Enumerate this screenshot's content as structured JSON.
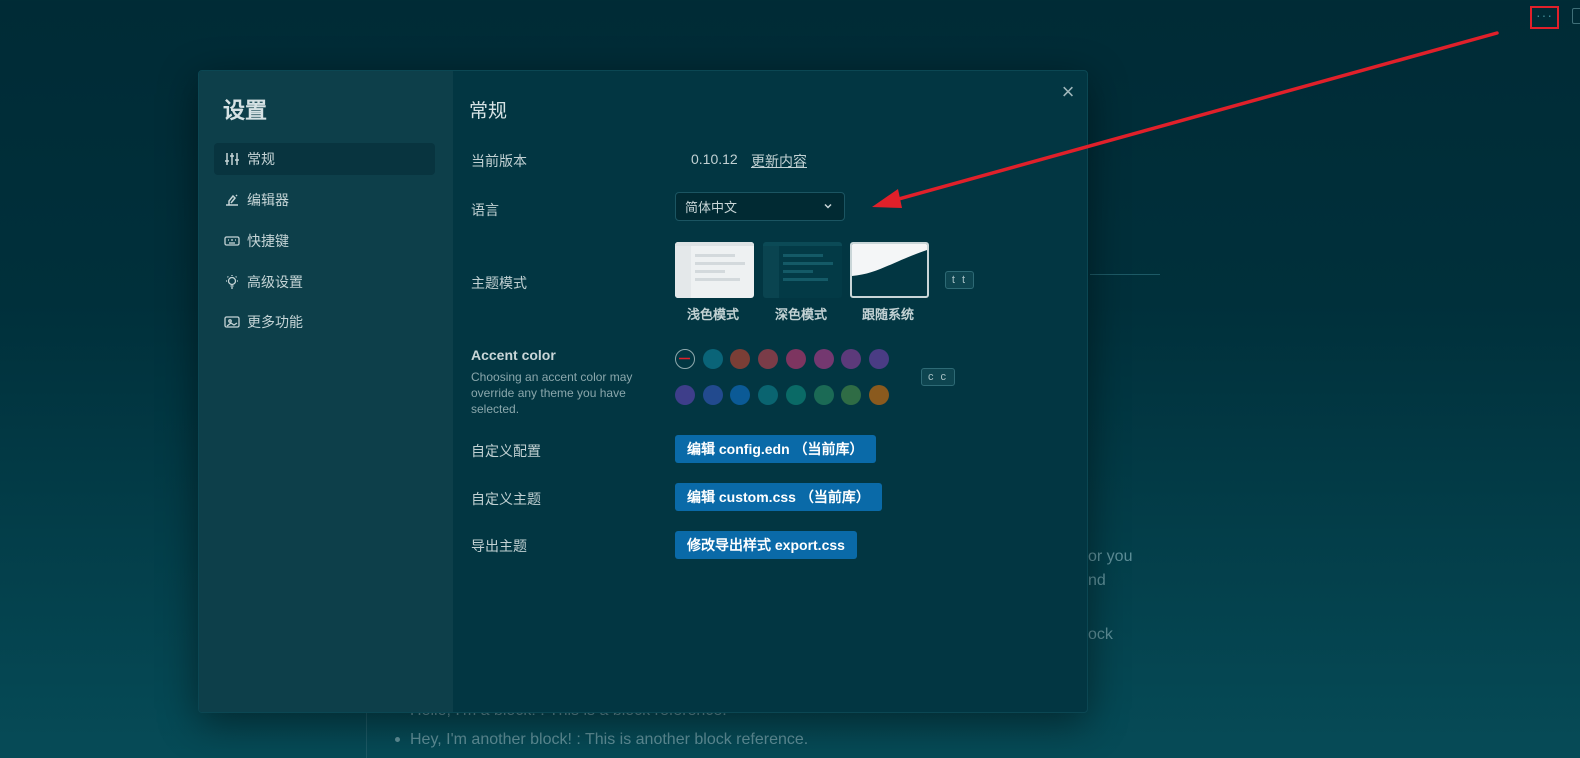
{
  "background": {
    "more_icon": "···",
    "fragments": [
      "or you",
      "nd",
      "ock"
    ],
    "blocks": [
      "Hello, I'm a block! : This is a block reference.",
      "Hey, I'm another block! : This is another block reference."
    ]
  },
  "modal": {
    "title": "设置",
    "close_icon": "×",
    "sidebar": [
      {
        "label": "常规",
        "icon": "sliders-icon",
        "active": true
      },
      {
        "label": "编辑器",
        "icon": "pen-icon"
      },
      {
        "label": "快捷键",
        "icon": "keyboard-icon"
      },
      {
        "label": "高级设置",
        "icon": "bulb-icon"
      },
      {
        "label": "更多功能",
        "icon": "photo-icon"
      }
    ],
    "section_title": "常规",
    "version": {
      "label": "当前版本",
      "value": "0.10.12",
      "link": "更新内容"
    },
    "language": {
      "label": "语言",
      "value": "简体中文"
    },
    "theme": {
      "label": "主题模式",
      "options": [
        "浅色模式",
        "深色模式",
        "跟随系统"
      ],
      "selected": "跟随系统",
      "shortcut": "t t"
    },
    "accent": {
      "title": "Accent color",
      "description": "Choosing an accent color may override any theme you have selected.",
      "shortcut": "c c",
      "row1": [
        "#023642",
        "#0a6478",
        "#7a3e36",
        "#7a3c48",
        "#7d3560",
        "#743870",
        "#5c3a7a",
        "#4a3c84"
      ],
      "row2": [
        "#3e3e8a",
        "#224a8e",
        "#0b5a96",
        "#0a6470",
        "#0a6a66",
        "#1b6a55",
        "#2f6c45",
        "#8a5a1e"
      ]
    },
    "custom_config": {
      "label": "自定义配置",
      "button": "编辑 config.edn （当前库）"
    },
    "custom_theme": {
      "label": "自定义主题",
      "button": "编辑 custom.css （当前库）"
    },
    "export_theme": {
      "label": "导出主题",
      "button": "修改导出样式 export.css"
    }
  },
  "colors": {
    "accent_button": "#0a6aa8",
    "annotation": "#e0202a"
  }
}
